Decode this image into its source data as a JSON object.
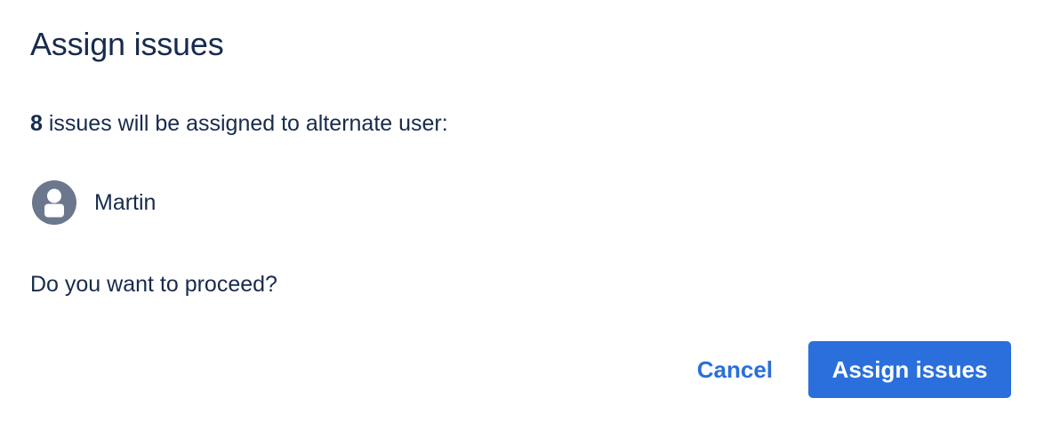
{
  "dialog": {
    "title": "Assign issues",
    "summary": {
      "count": "8",
      "text": " issues will be assigned to alternate user:"
    },
    "user": {
      "avatar_icon": "user-avatar-icon",
      "name": "Martin"
    },
    "question": "Do you want to proceed?",
    "actions": {
      "cancel_label": "Cancel",
      "confirm_label": "Assign issues"
    }
  },
  "colors": {
    "text": "#172b4d",
    "accent": "#2a6fdb",
    "avatar": "#6b778c"
  }
}
